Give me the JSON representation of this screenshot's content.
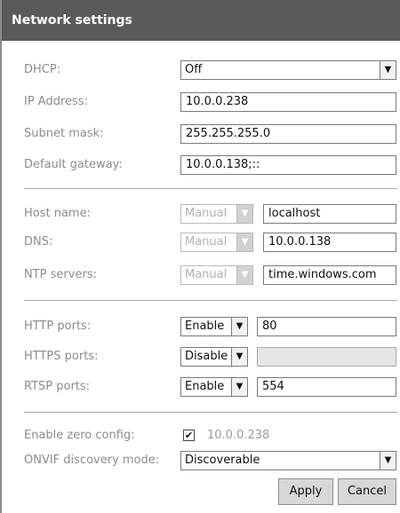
{
  "header": {
    "title": "Network settings"
  },
  "network": {
    "dhcp_label": "DHCP:",
    "dhcp_value": "Off",
    "ip_label": "IP Address:",
    "ip_value": "10.0.0.238",
    "subnet_label": "Subnet mask:",
    "subnet_value": "255.255.255.0",
    "gateway_label": "Default gateway:",
    "gateway_value": "10.0.0.138;::"
  },
  "naming": {
    "host_label": "Host name:",
    "host_mode": "Manual",
    "host_value": "localhost",
    "dns_label": "DNS:",
    "dns_mode": "Manual",
    "dns_value": "10.0.0.138",
    "ntp_label": "NTP servers:",
    "ntp_mode": "Manual",
    "ntp_value": "time.windows.com"
  },
  "ports": {
    "http_label": "HTTP ports:",
    "http_mode": "Enable",
    "http_value": "80",
    "https_label": "HTTPS ports:",
    "https_mode": "Disable",
    "https_value": "",
    "rtsp_label": "RTSP ports:",
    "rtsp_mode": "Enable",
    "rtsp_value": "554"
  },
  "discovery": {
    "zero_config_label": "Enable zero config:",
    "zero_config_checked": true,
    "zero_config_value": "10.0.0.238",
    "onvif_label": "ONVIF discovery mode:",
    "onvif_value": "Discoverable"
  },
  "actions": {
    "apply_label": "Apply",
    "cancel_label": "Cancel"
  },
  "icons": {
    "dropdown": "chevron-down-icon",
    "check": "check-icon"
  },
  "colors": {
    "header_bg": "#5a5a5a",
    "label_text": "#8c8c8c",
    "disabled_bg": "#e6e6e6",
    "button_bg": "#d8d8d8"
  }
}
